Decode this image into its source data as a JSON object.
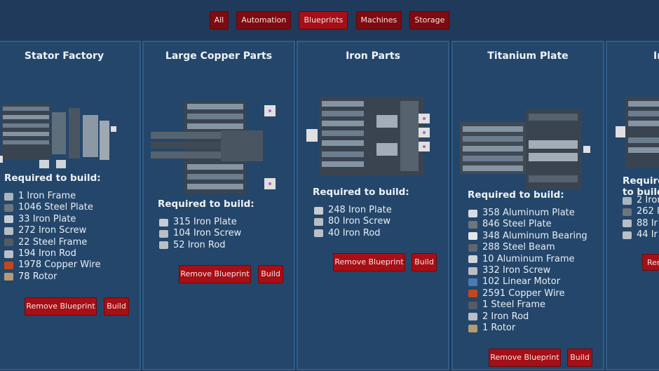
{
  "filters": [
    {
      "label": "All",
      "active": false
    },
    {
      "label": "Automation",
      "active": false
    },
    {
      "label": "Blueprints",
      "active": true
    },
    {
      "label": "Machines",
      "active": false
    },
    {
      "label": "Storage",
      "active": false
    }
  ],
  "required_label": "Required to build:",
  "remove_label": "Remove Blueprint",
  "build_label": "Build",
  "cards": [
    {
      "title": "Stator Factory",
      "materials": [
        {
          "qty": "1",
          "name": "Iron Frame",
          "icon": "iron-frame-icon",
          "color": "#a9b4bf"
        },
        {
          "qty": "1046",
          "name": "Steel Plate",
          "icon": "steel-plate-icon",
          "color": "#6d757d"
        },
        {
          "qty": "33",
          "name": "Iron Plate",
          "icon": "iron-plate-icon",
          "color": "#c5ccd3"
        },
        {
          "qty": "272",
          "name": "Iron Screw",
          "icon": "iron-screw-icon",
          "color": "#b7bec5"
        },
        {
          "qty": "22",
          "name": "Steel Frame",
          "icon": "steel-frame-icon",
          "color": "#545b62"
        },
        {
          "qty": "194",
          "name": "Iron Rod",
          "icon": "iron-rod-icon",
          "color": "#b9c0c7"
        },
        {
          "qty": "1978",
          "name": "Copper Wire",
          "icon": "copper-wire-icon",
          "color": "#c2471f"
        },
        {
          "qty": "78",
          "name": "Rotor",
          "icon": "rotor-icon",
          "color": "#b59a74"
        }
      ]
    },
    {
      "title": "Large Copper Parts",
      "materials": [
        {
          "qty": "315",
          "name": "Iron Plate",
          "icon": "iron-plate-icon",
          "color": "#c5ccd3"
        },
        {
          "qty": "104",
          "name": "Iron Screw",
          "icon": "iron-screw-icon",
          "color": "#b7bec5"
        },
        {
          "qty": "52",
          "name": "Iron Rod",
          "icon": "iron-rod-icon",
          "color": "#b9c0c7"
        }
      ]
    },
    {
      "title": "Iron Parts",
      "materials": [
        {
          "qty": "248",
          "name": "Iron Plate",
          "icon": "iron-plate-icon",
          "color": "#c5ccd3"
        },
        {
          "qty": "80",
          "name": "Iron Screw",
          "icon": "iron-screw-icon",
          "color": "#b7bec5"
        },
        {
          "qty": "40",
          "name": "Iron Rod",
          "icon": "iron-rod-icon",
          "color": "#b9c0c7"
        }
      ]
    },
    {
      "title": "Titanium Plate",
      "materials": [
        {
          "qty": "358",
          "name": "Aluminum Plate",
          "icon": "aluminum-plate-icon",
          "color": "#d9dde1"
        },
        {
          "qty": "846",
          "name": "Steel Plate",
          "icon": "steel-plate-icon",
          "color": "#6d757d"
        },
        {
          "qty": "348",
          "name": "Aluminum Bearing",
          "icon": "aluminum-bearing-icon",
          "color": "#e4e7ea"
        },
        {
          "qty": "288",
          "name": "Steel Beam",
          "icon": "steel-beam-icon",
          "color": "#5f666d"
        },
        {
          "qty": "10",
          "name": "Aluminum Frame",
          "icon": "aluminum-frame-icon",
          "color": "#d1d6db"
        },
        {
          "qty": "332",
          "name": "Iron Screw",
          "icon": "iron-screw-icon",
          "color": "#b7bec5"
        },
        {
          "qty": "102",
          "name": "Linear Motor",
          "icon": "linear-motor-icon",
          "color": "#4a7bb0"
        },
        {
          "qty": "2591",
          "name": "Copper Wire",
          "icon": "copper-wire-icon",
          "color": "#c2471f"
        },
        {
          "qty": "1",
          "name": "Steel Frame",
          "icon": "steel-frame-icon",
          "color": "#545b62"
        },
        {
          "qty": "2",
          "name": "Iron Rod",
          "icon": "iron-rod-icon",
          "color": "#b9c0c7"
        },
        {
          "qty": "1",
          "name": "Rotor",
          "icon": "rotor-icon",
          "color": "#b59a74"
        }
      ]
    },
    {
      "title": "Ir",
      "materials": [
        {
          "qty": "2",
          "name": "Iror",
          "icon": "iron-frame-icon",
          "color": "#a9b4bf"
        },
        {
          "qty": "262",
          "name": "I",
          "icon": "steel-plate-icon",
          "color": "#6d757d"
        },
        {
          "qty": "88",
          "name": "Ir",
          "icon": "iron-screw-icon",
          "color": "#b7bec5"
        },
        {
          "qty": "44",
          "name": "Ir",
          "icon": "iron-rod-icon",
          "color": "#b9c0c7"
        }
      ]
    }
  ]
}
